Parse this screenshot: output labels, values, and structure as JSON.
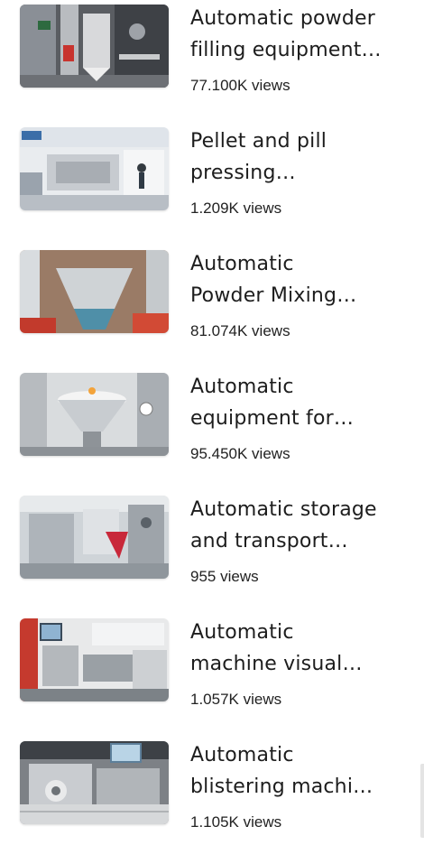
{
  "videos": [
    {
      "title_line1": "Automatic powder",
      "title_line2": "filling equipment…",
      "views": "77.100K views",
      "thumbnail": "powder-filling-machine-thumbnail"
    },
    {
      "title_line1": "Pellet and pill",
      "title_line2": "pressing…",
      "views": "1.209K views",
      "thumbnail": "pill-pressing-exhibition-thumbnail"
    },
    {
      "title_line1": "Automatic",
      "title_line2": "Powder Mixing…",
      "views": "81.074K views",
      "thumbnail": "powder-mixing-hopper-thumbnail"
    },
    {
      "title_line1": "Automatic",
      "title_line2": "equipment for…",
      "views": "95.450K views",
      "thumbnail": "steel-funnel-equipment-thumbnail"
    },
    {
      "title_line1": "Automatic storage",
      "title_line2": "and transport…",
      "views": "955 views",
      "thumbnail": "storage-transport-machine-thumbnail"
    },
    {
      "title_line1": "Automatic",
      "title_line2": "machine visual…",
      "views": "1.057K views",
      "thumbnail": "visual-inspection-machine-thumbnail"
    },
    {
      "title_line1": "Automatic",
      "title_line2": "blistering machi…",
      "views": "1.105K views",
      "thumbnail": "blistering-machine-thumbnail"
    }
  ]
}
